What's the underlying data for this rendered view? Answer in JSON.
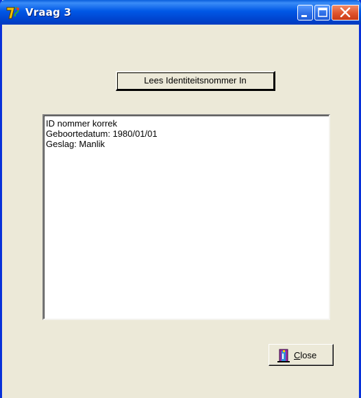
{
  "window": {
    "title": "Vraag 3",
    "controls": [
      "minimize",
      "maximize",
      "close"
    ]
  },
  "read_button": {
    "label": "Lees Identiteitsnommer In"
  },
  "output_memo": {
    "lines": [
      "ID nommer korrek",
      "Geboortedatum: 1980/01/01",
      "Geslag: Manlik"
    ]
  },
  "close_button": {
    "mnemonic": "C",
    "rest": "lose",
    "icon": "door-exit-icon"
  },
  "colors": {
    "titlebar": "#0058e6",
    "form_background": "#ece9d8",
    "close_control": "#e0542d"
  }
}
